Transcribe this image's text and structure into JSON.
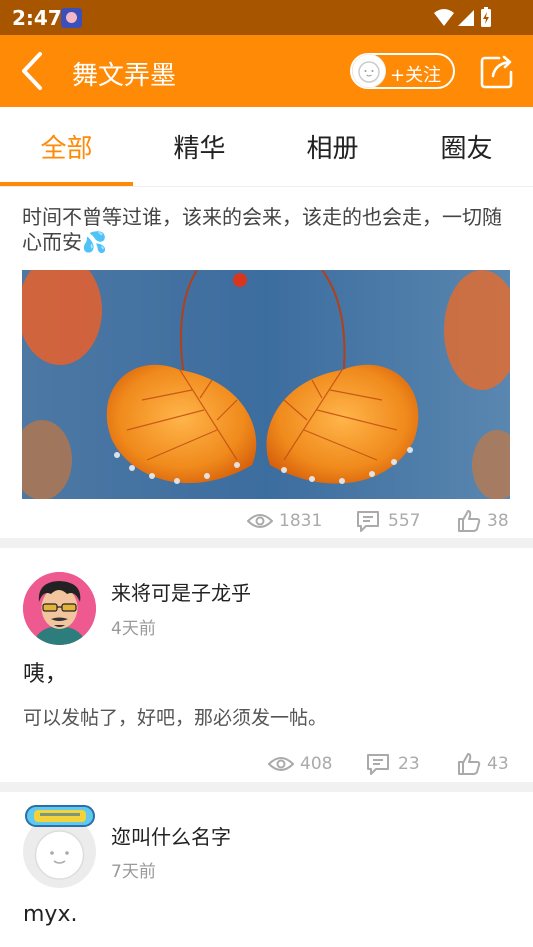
{
  "status_bar": {
    "time": "2:47"
  },
  "app_bar": {
    "title": "舞文弄墨",
    "follow_label": "+关注"
  },
  "tabs": [
    {
      "label": "全部",
      "active": true
    },
    {
      "label": "精华",
      "active": false
    },
    {
      "label": "相册",
      "active": false
    },
    {
      "label": "圈友",
      "active": false
    }
  ],
  "posts": [
    {
      "text": "时间不曾等过谁，该来的会来，该走的也会走，一切随心而安💦",
      "views": "1831",
      "comments": "557",
      "likes": "38"
    },
    {
      "author": "来将可是子龙乎",
      "time": "4天前",
      "title": "咦，",
      "body": "可以发帖了，好吧，那必须发一帖。",
      "views": "408",
      "comments": "23",
      "likes": "43"
    },
    {
      "author": "迩叫什么名字",
      "time": "7天前",
      "title": "myx."
    }
  ],
  "colors": {
    "accent": "#fe8a06",
    "status_bar": "#a85500",
    "muted": "#aaaaaa"
  }
}
